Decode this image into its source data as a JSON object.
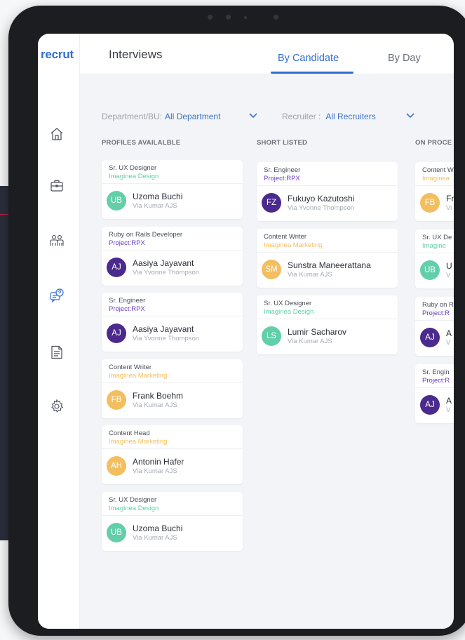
{
  "app": {
    "logo": "recrut",
    "page_title": "Interviews",
    "tabs": [
      {
        "label": "By Candidate",
        "active": true
      },
      {
        "label": "By Day",
        "active": false
      }
    ]
  },
  "sidebar": {
    "items": [
      {
        "name": "home",
        "icon": "home-icon"
      },
      {
        "name": "jobs",
        "icon": "briefcase-icon"
      },
      {
        "name": "candidates",
        "icon": "people-icon"
      },
      {
        "name": "interviews",
        "icon": "chat-question-icon",
        "active": true
      },
      {
        "name": "documents",
        "icon": "document-icon"
      },
      {
        "name": "settings",
        "icon": "gear-icon"
      }
    ]
  },
  "filters": {
    "department": {
      "label": "Department/BU:",
      "value": "All Department"
    },
    "recruiter": {
      "label": "Recruiter :",
      "value": "All Recruiters"
    }
  },
  "colors": {
    "accent": "#2f6ed8",
    "project_purple": "#6a3cc2",
    "imaginea_green": "#5fcfa6",
    "marketing_orange": "#f4bf5e",
    "avatar_purple": "#4a2a8c",
    "avatar_teal": "#62cfa9",
    "avatar_yellow": "#f2be5f"
  },
  "columns": [
    {
      "title": "PROFILES AVAILALBLE",
      "cards": [
        {
          "role": "Sr. UX Designer",
          "project": "Imaginea Design",
          "project_color": "#5fcfa6",
          "initials": "UB",
          "avatar_color": "#62cfa9",
          "name": "Uzoma Buchi",
          "via": "Via Kumar AJS"
        },
        {
          "role": "Ruby on Rails Developer",
          "project": "Project:RPX",
          "project_color": "#6a3cc2",
          "initials": "AJ",
          "avatar_color": "#4a2a8c",
          "name": "Aasiya Jayavant",
          "via": "Via Yvonne Thompson"
        },
        {
          "role": "Sr. Engineer",
          "project": "Project:RPX",
          "project_color": "#6a3cc2",
          "initials": "AJ",
          "avatar_color": "#4a2a8c",
          "name": "Aasiya Jayavant",
          "via": "Via Yvonne Thompson"
        },
        {
          "role": "Content Writer",
          "project": "Imaginea Marketing",
          "project_color": "#f4bf5e",
          "initials": "FB",
          "avatar_color": "#f2be5f",
          "name": "Frank Boehm",
          "via": "Via Kumar AJS"
        },
        {
          "role": "Content Head",
          "project": "Imaginea Marketing",
          "project_color": "#f4bf5e",
          "initials": "AH",
          "avatar_color": "#f2be5f",
          "name": "Antonin Hafer",
          "via": "Via Kumar AJS"
        },
        {
          "role": "Sr. UX Designer",
          "project": "Imaginea Design",
          "project_color": "#5fcfa6",
          "initials": "UB",
          "avatar_color": "#62cfa9",
          "name": "Uzoma Buchi",
          "via": "Via Kumar AJS"
        }
      ]
    },
    {
      "title": "SHORT LISTED",
      "cards": [
        {
          "role": "Sr. Engineer",
          "project": "Project:RPX",
          "project_color": "#6a3cc2",
          "initials": "FZ",
          "avatar_color": "#4a2a8c",
          "name": "Fukuyo Kazutoshi",
          "via": "Via Yvonne Thompson"
        },
        {
          "role": "Content Writer",
          "project": "Imaginea Marketing",
          "project_color": "#f4bf5e",
          "initials": "SM",
          "avatar_color": "#f2be5f",
          "name": "Sunstra Maneerattana",
          "via": "Via Kumar AJS"
        },
        {
          "role": "Sr. UX Designer",
          "project": "Imaginea Design",
          "project_color": "#5fcfa6",
          "initials": "LS",
          "avatar_color": "#62cfa9",
          "name": "Lumir Sacharov",
          "via": "Via Kumar AJS"
        }
      ]
    },
    {
      "title": "ON PROCE",
      "cards": [
        {
          "role": "Content W",
          "project": "Imaginea",
          "project_color": "#f4bf5e",
          "initials": "FB",
          "avatar_color": "#f2be5f",
          "name": "Fr",
          "via": "Vi"
        },
        {
          "role": "Sr. UX De",
          "project": "Imagine",
          "project_color": "#5fcfa6",
          "initials": "UB",
          "avatar_color": "#62cfa9",
          "name": "U",
          "via": "V"
        },
        {
          "role": "Ruby on R",
          "project": "Project:R",
          "project_color": "#6a3cc2",
          "initials": "AJ",
          "avatar_color": "#4a2a8c",
          "name": "A",
          "via": "V"
        },
        {
          "role": "Sr. Engin",
          "project": "Project:R",
          "project_color": "#6a3cc2",
          "initials": "AJ",
          "avatar_color": "#4a2a8c",
          "name": "A",
          "via": "V"
        }
      ]
    }
  ]
}
